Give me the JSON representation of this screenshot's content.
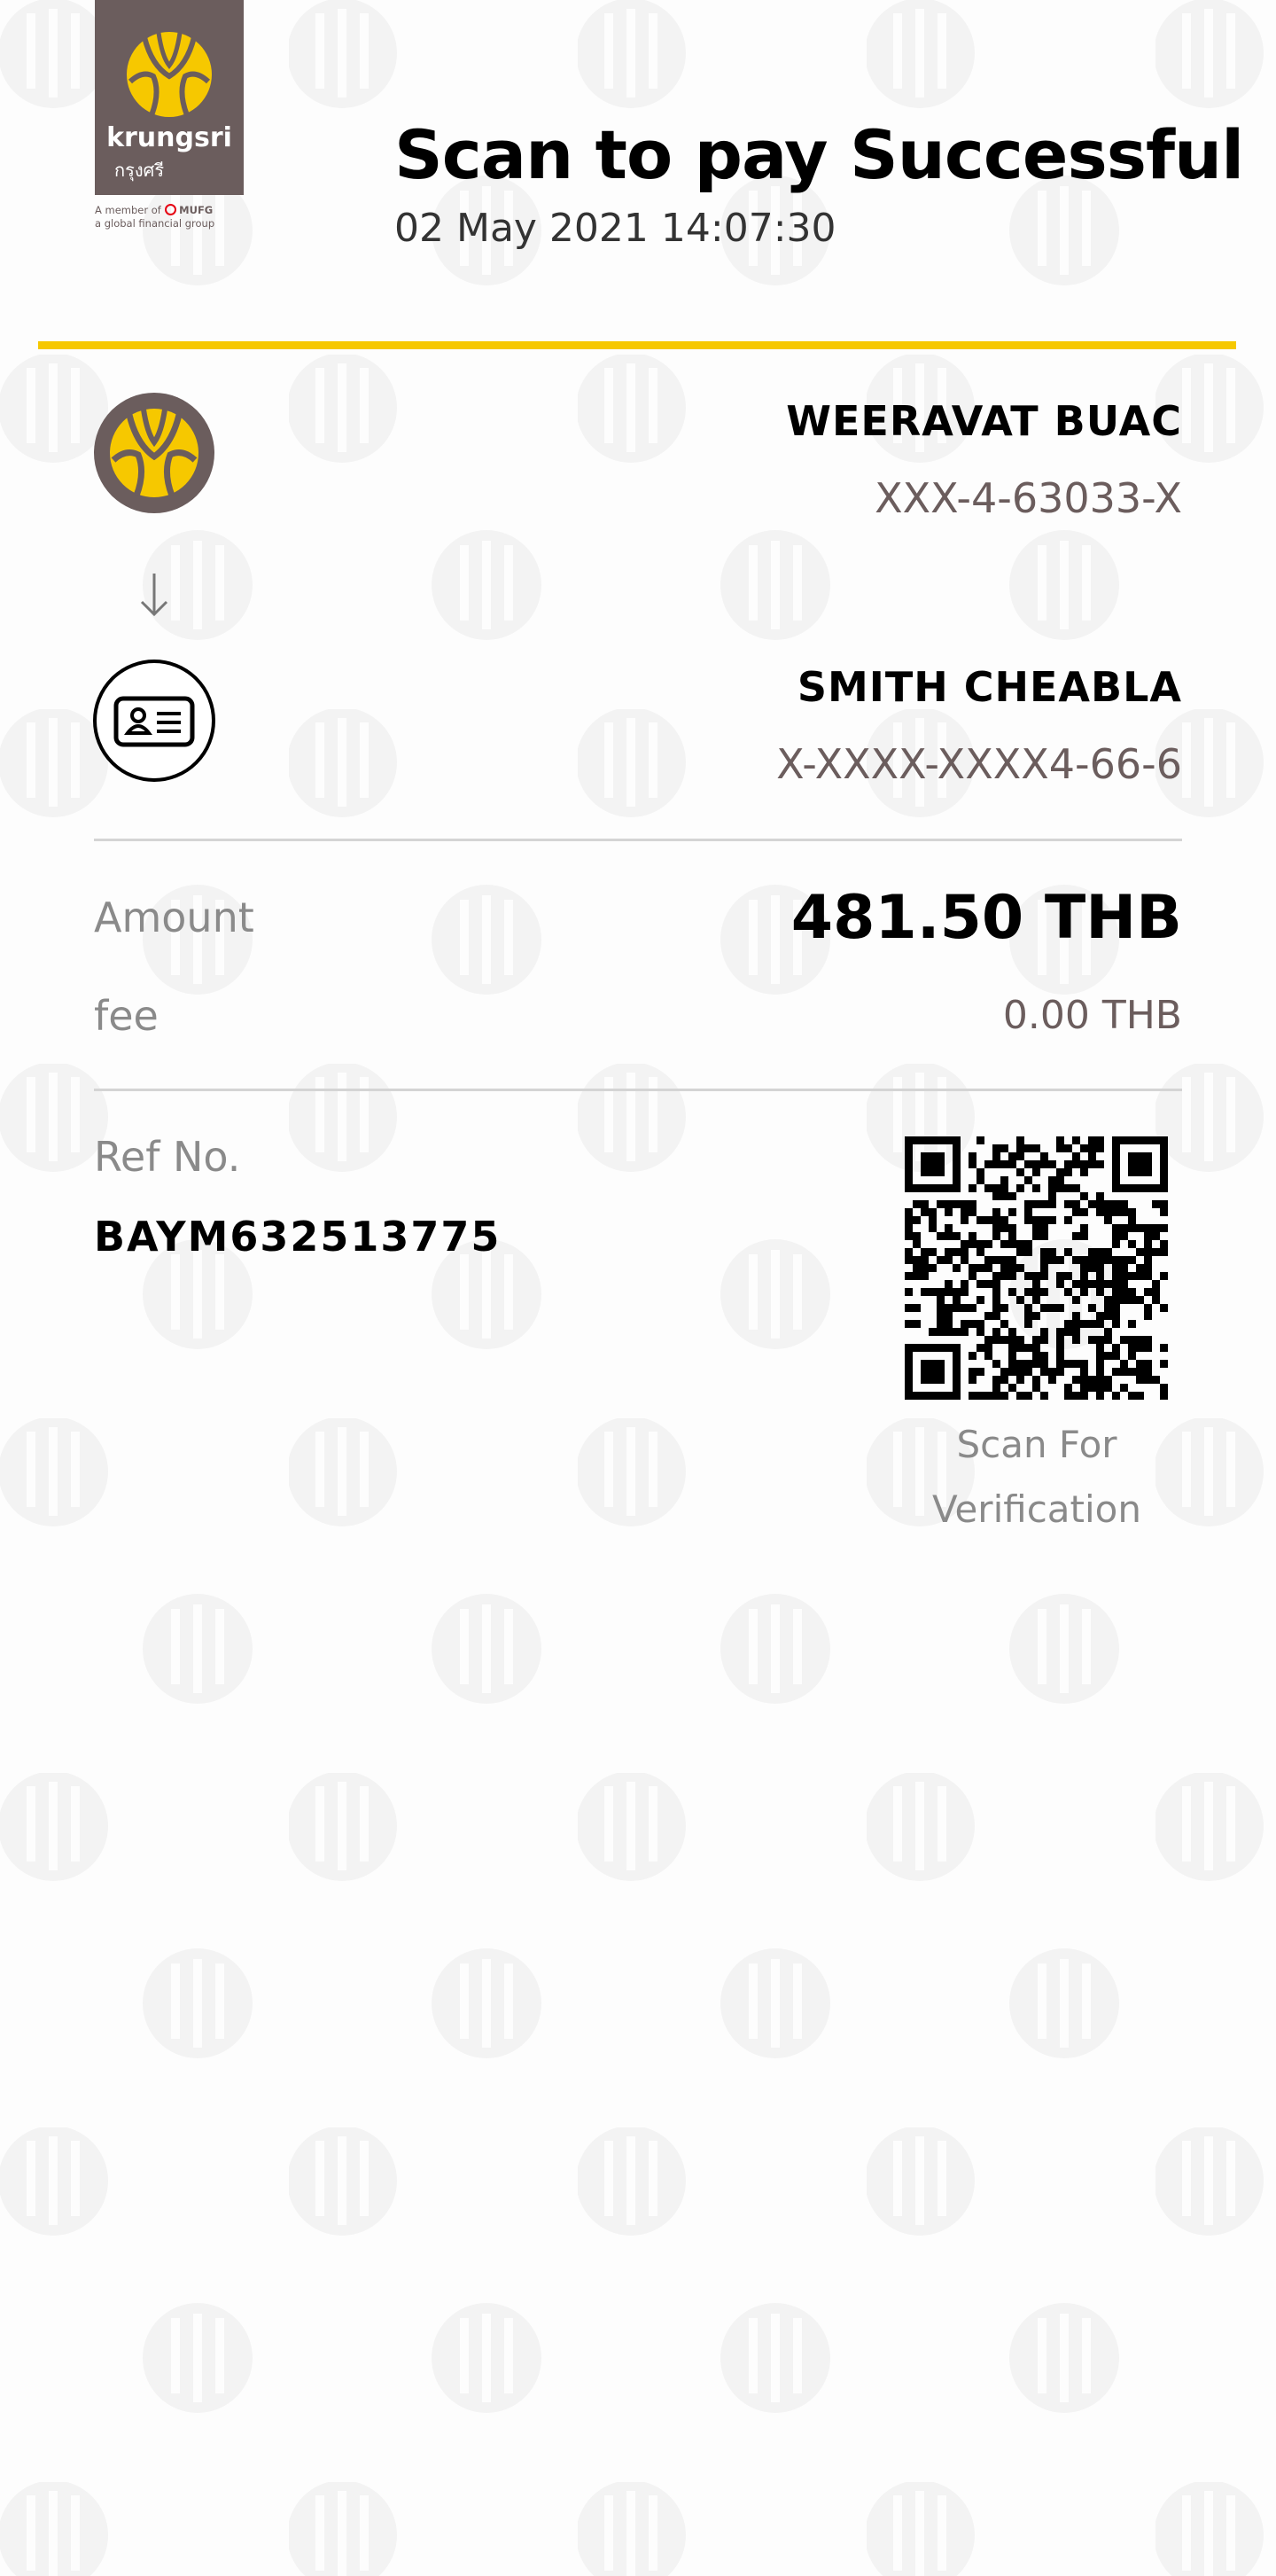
{
  "brand": {
    "name": "krungsri",
    "name_thai": "กรุงศรี",
    "tagline_1": "A member of",
    "tagline_mufg": "MUFG",
    "tagline_2": "a global financial group",
    "colors": {
      "brand_brown": "#6b5d5d",
      "brand_yellow": "#f6c800",
      "mufg_red": "#e60012"
    }
  },
  "header": {
    "title": "Scan to pay Successful",
    "datetime": "02 May 2021 14:07:30"
  },
  "sender": {
    "icon": "krungsri-bank-icon",
    "name": "WEERAVAT BUAC",
    "account": "XXX-4-63033-X"
  },
  "transfer_icon": "arrow-down-icon",
  "receiver": {
    "icon": "id-card-icon",
    "name": "SMITH CHEABLA",
    "account": "X-XXXX-XXXX4-66-6"
  },
  "amount": {
    "label": "Amount",
    "value": "481.50 THB"
  },
  "fee": {
    "label": "fee",
    "value": "0.00 THB"
  },
  "reference": {
    "label": "Ref No.",
    "value": "BAYM632513775"
  },
  "verification": {
    "line1": "Scan For",
    "line2": "Verification"
  }
}
